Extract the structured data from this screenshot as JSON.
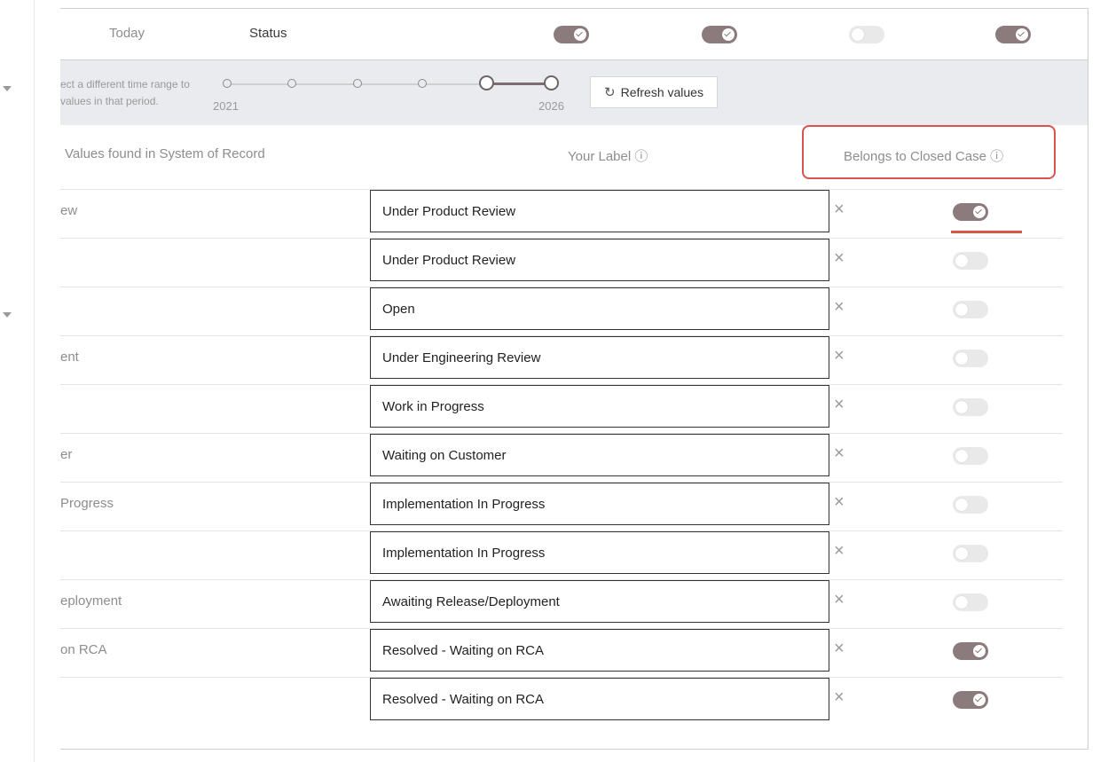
{
  "topbar": {
    "today": "Today",
    "status": "Status",
    "toggles": [
      true,
      true,
      false,
      true
    ]
  },
  "time_range": {
    "hint_line1": "ect a different time range to",
    "hint_line2": " values in that period.",
    "year_start": "2021",
    "year_end": "2026",
    "refresh_label": "Refresh values",
    "refresh_icon": "refresh-icon"
  },
  "columns": {
    "source": "Values found in System of Record",
    "label": "Your Label ⓘ",
    "closed": "Belongs to Closed Case ⓘ"
  },
  "rows": [
    {
      "source": "ew",
      "label": "Under Product Review",
      "closed": true
    },
    {
      "source": "",
      "label": "Under Product Review",
      "closed": false
    },
    {
      "source": "",
      "label": "Open",
      "closed": false
    },
    {
      "source": "ent",
      "label": "Under Engineering Review",
      "closed": false
    },
    {
      "source": "",
      "label": "Work in Progress",
      "closed": false
    },
    {
      "source": "er",
      "label": "Waiting on Customer",
      "closed": false
    },
    {
      "source": "Progress",
      "label": "Implementation In Progress",
      "closed": false
    },
    {
      "source": "",
      "label": "Implementation In Progress",
      "closed": false
    },
    {
      "source": "eployment",
      "label": "Awaiting Release/Deployment",
      "closed": false
    },
    {
      "source": "on RCA",
      "label": "Resolved - Waiting on RCA",
      "closed": true
    },
    {
      "source": "",
      "label": "Resolved - Waiting on RCA",
      "closed": true
    }
  ],
  "clear_symbol": "×",
  "colors": {
    "toggle_on": "#8c7b7c",
    "toggle_off": "#e9e9e9",
    "highlight": "#d9534f"
  }
}
